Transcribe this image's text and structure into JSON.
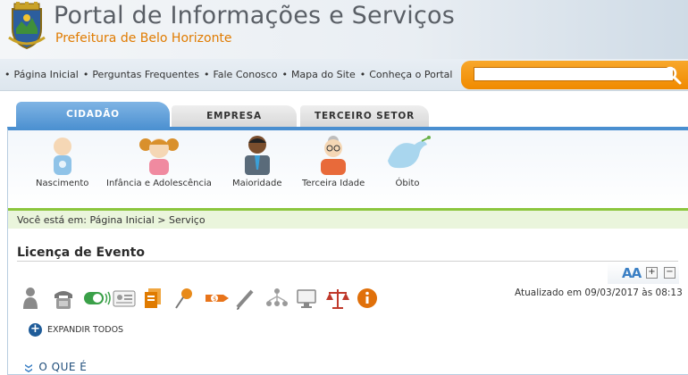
{
  "header": {
    "title": "Portal de Informações e Serviços",
    "subtitle": "Prefeitura de Belo Horizonte"
  },
  "topnav": {
    "links": [
      "Página Inicial",
      "Perguntas Frequentes",
      "Fale Conosco",
      "Mapa do Site",
      "Conheça o Portal"
    ],
    "search_value": ""
  },
  "tabs": [
    "CIDADÃO",
    "EMPRESA",
    "TERCEIRO SETOR"
  ],
  "life_stages": [
    "Nascimento",
    "Infância e Adolescência",
    "Maioridade",
    "Terceira Idade",
    "Óbito"
  ],
  "breadcrumb": {
    "prefix": "Você está em:",
    "path": "Página Inicial > Serviço"
  },
  "page": {
    "title": "Licença de Evento",
    "font_label": "AA",
    "font_plus": "+",
    "font_minus": "−",
    "updated": "Atualizado em 09/03/2017 às 08:13",
    "expand_label": "EXPANDIR TODOS",
    "section_label": "O QUE É"
  },
  "service_icons": [
    "person-icon",
    "phone-icon",
    "toggle-icon",
    "id-card-icon",
    "documents-icon",
    "pin-icon",
    "money-icon",
    "pen-icon",
    "network-icon",
    "monitor-icon",
    "scale-icon",
    "info-icon"
  ],
  "colors": {
    "accent_blue": "#4a8fd0",
    "brand_orange": "#f08a00",
    "breadcrumb_green": "#8cc63e"
  }
}
